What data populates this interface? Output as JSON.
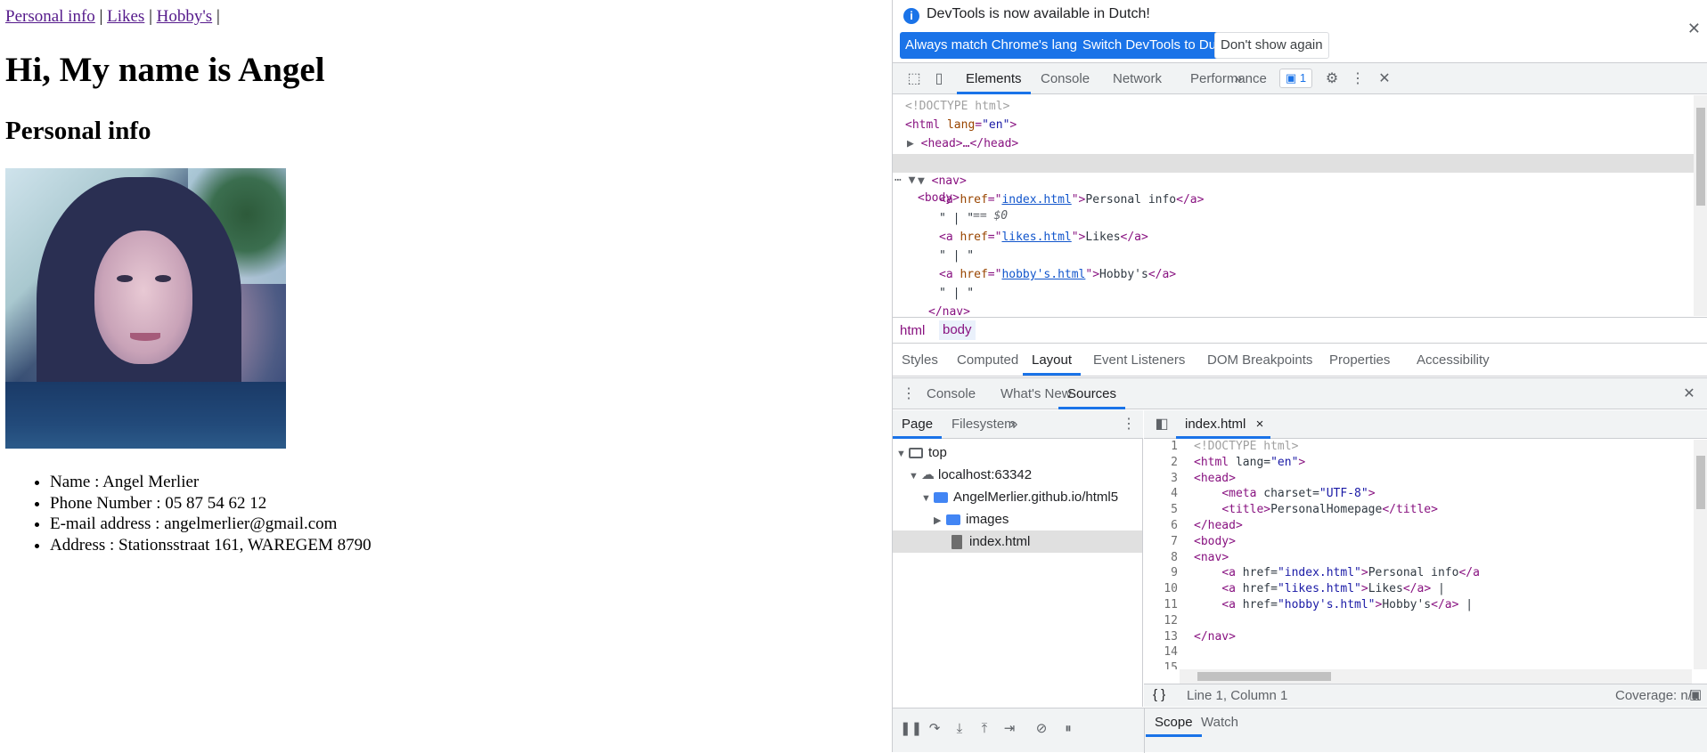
{
  "page": {
    "nav": [
      {
        "label": "Personal info"
      },
      {
        "label": "Likes"
      },
      {
        "label": "Hobby's"
      }
    ],
    "nav_separator": "|",
    "heading": "Hi, My name is Angel",
    "subheading": "Personal info",
    "info_items": [
      "Name : Angel Merlier",
      "Phone Number : 05 87 54 62 12",
      "E-mail address : angelmerlier@gmail.com",
      "Address : Stationsstraat 161, WAREGEM 8790"
    ]
  },
  "devtools": {
    "infobar": {
      "message": "DevTools is now available in Dutch!",
      "btn_match": "Always match Chrome's language",
      "btn_switch": "Switch DevTools to Dutch",
      "btn_dont_show": "Don't show again"
    },
    "main_tabs": [
      "Elements",
      "Console",
      "Network",
      "Performance"
    ],
    "issues_count": "1",
    "elements_lines": {
      "doctype": "<!DOCTYPE html>",
      "html_open": "<html lang=\"en\">",
      "head": "<head>…</head>",
      "body_open": "<body>",
      "body_marker": "== $0",
      "nav_open": "<nav>",
      "a1_text": "Personal info",
      "a1_href": "index.html",
      "a2_text": "Likes",
      "a2_href": "likes.html",
      "a3_text": "Hobby's",
      "a3_href": "hobby's.html",
      "sep_text": "\" | \"",
      "nav_close": "</nav>"
    },
    "breadcrumbs": [
      "html",
      "body"
    ],
    "sub_tabs": [
      "Styles",
      "Computed",
      "Layout",
      "Event Listeners",
      "DOM Breakpoints",
      "Properties",
      "Accessibility"
    ],
    "drawer_tabs": [
      "Console",
      "What's New",
      "Sources"
    ],
    "sources": {
      "nav_tabs": [
        "Page",
        "Filesystem"
      ],
      "tree": {
        "top": "top",
        "host": "localhost:63342",
        "folder": "AngelMerlier.github.io/html5",
        "images": "images",
        "file": "index.html"
      },
      "open_file": "index.html",
      "code_lines": [
        "<!DOCTYPE html>",
        "<html lang=\"en\">",
        "<head>",
        "    <meta charset=\"UTF-8\">",
        "    <title>PersonalHomepage</title>",
        "</head>",
        "<body>",
        "<nav>",
        "    <a href=\"index.html\">Personal info</a",
        "    <a href=\"likes.html\">Likes</a> |",
        "    <a href=\"hobby's.html\">Hobby's</a> |",
        "",
        "</nav>",
        "",
        ""
      ],
      "status_position": "Line 1, Column 1",
      "status_coverage": "Coverage: n/a"
    },
    "debug_tabs": [
      "Scope",
      "Watch"
    ]
  }
}
